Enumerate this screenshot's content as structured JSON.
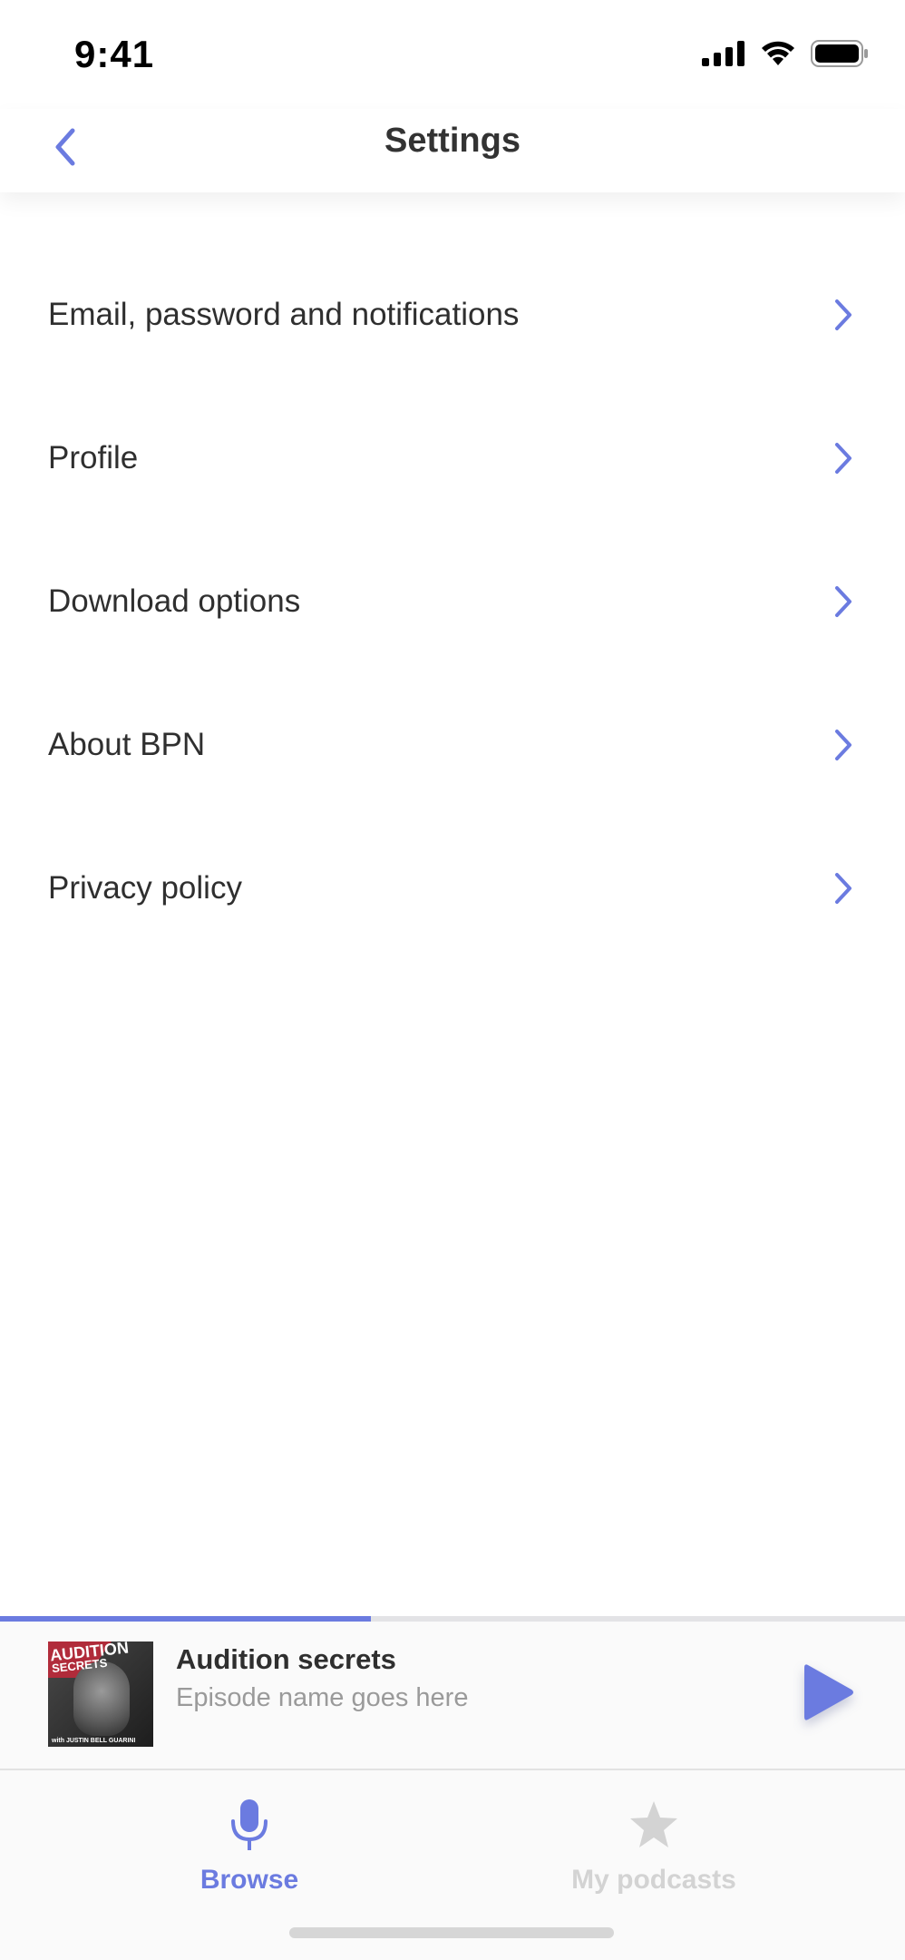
{
  "status_bar": {
    "time": "9:41",
    "icons": [
      "cellular-signal-icon",
      "wifi-icon",
      "battery-icon"
    ]
  },
  "nav": {
    "title": "Settings",
    "back_icon": "chevron-left-icon"
  },
  "settings": {
    "items": [
      {
        "label": "Email, password and notifications"
      },
      {
        "label": "Profile"
      },
      {
        "label": "Download options"
      },
      {
        "label": "About BPN"
      },
      {
        "label": "Privacy policy"
      }
    ],
    "chevron_icon": "chevron-right-icon"
  },
  "player": {
    "progress_fraction": 0.41,
    "show_title": "Audition secrets",
    "episode_name": "Episode name goes here",
    "cover_text_1": "AUDITION",
    "cover_text_2": "SECRETS",
    "cover_host": "with JUSTIN BELL GUARINI",
    "play_icon": "play-icon"
  },
  "tabs": [
    {
      "label": "Browse",
      "icon": "microphone-icon",
      "active": true
    },
    {
      "label": "My podcasts",
      "icon": "star-icon",
      "active": false
    }
  ],
  "colors": {
    "accent": "#6b7be0",
    "text": "#2f2f2f",
    "muted": "#9a9a9a",
    "inactive_tab": "#d3d3d3"
  }
}
